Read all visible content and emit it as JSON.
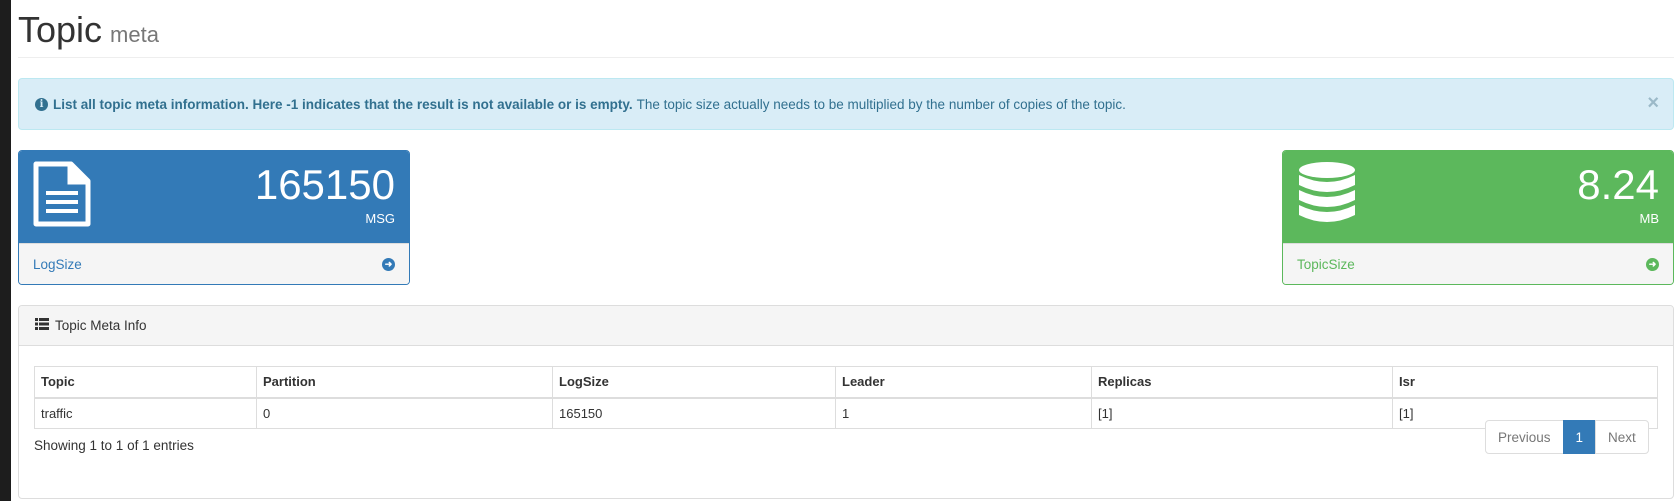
{
  "header": {
    "title": "Topic",
    "subtitle": "meta"
  },
  "alert": {
    "strong_text": "List all topic meta information. Here -1 indicates that the result is not available or is empty.",
    "text": "The topic size actually needs to be multiplied by the number of copies of the topic.",
    "close_symbol": "×",
    "info_icon": "info-circle-icon"
  },
  "stats": {
    "log_size": {
      "value": "165150",
      "unit": "MSG",
      "label": "LogSize",
      "icon": "file-text-icon",
      "color": "#337ab7"
    },
    "topic_size": {
      "value": "8.24",
      "unit": "MB",
      "label": "TopicSize",
      "icon": "database-icon",
      "color": "#5cb85c"
    }
  },
  "panel": {
    "title": "Topic Meta Info",
    "icon": "list-icon"
  },
  "table": {
    "columns": [
      "Topic",
      "Partition",
      "LogSize",
      "Leader",
      "Replicas",
      "Isr"
    ],
    "rows": [
      [
        "traffic",
        "0",
        "165150",
        "1",
        "[1]",
        "[1]"
      ]
    ]
  },
  "footer": {
    "entries_info": "Showing 1 to 1 of 1 entries",
    "pagination": {
      "previous": "Previous",
      "current": "1",
      "next": "Next"
    }
  }
}
